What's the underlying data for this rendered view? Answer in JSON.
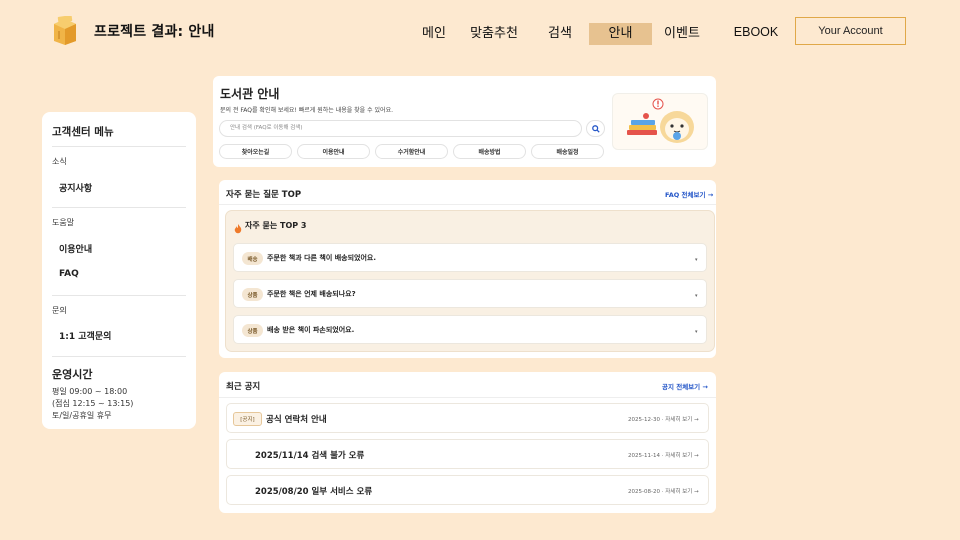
{
  "header": {
    "brand": "프로젝트 결과: 안내",
    "nav": [
      "메인",
      "맞춤추천",
      "검색",
      "안내",
      "이벤트",
      "EBOOK"
    ],
    "active_nav": "안내",
    "account_label": "Your Account"
  },
  "sidebar": {
    "title": "고객센터 메뉴",
    "sections": [
      {
        "heading": "소식",
        "items": [
          "공지사항"
        ]
      },
      {
        "heading": "도움말",
        "items": [
          "이용안내",
          "FAQ"
        ]
      },
      {
        "heading": "문의",
        "items": [
          "1:1 고객문의"
        ]
      }
    ],
    "hours": {
      "title": "운영시간",
      "lines": [
        "평일 09:00 ~ 18:00",
        "(점심 12:15 ~ 13:15)",
        "토/일/공휴일 휴무"
      ]
    }
  },
  "info": {
    "title": "도서관 안내",
    "subtitle": "문의 전 FAQ를 확인해 보세요! 빠르게 원하는 내용을 찾을 수 있어요.",
    "search_placeholder": "안내 검색 (FAQ로 이동해 검색)",
    "quick_links": [
      "찾아오는길",
      "이용안내",
      "수거함안내",
      "배송방법",
      "배송일정"
    ]
  },
  "faq": {
    "title": "자주 묻는 질문 TOP",
    "link": "FAQ 전체보기 →",
    "top_title": "자주 묻는 TOP 3",
    "items": [
      {
        "tag": "배송",
        "question": "주문한 책과 다른 책이 배송되었어요."
      },
      {
        "tag": "상품",
        "question": "주문한 책은 언제 배송되나요?"
      },
      {
        "tag": "상품",
        "question": "배송 받은 책이 파손되었어요."
      }
    ]
  },
  "notices": {
    "title": "최근 공지",
    "link": "공지 전체보기 →",
    "items": [
      {
        "tag": "[공지]",
        "title": "공식 연락처 안내",
        "meta": "2025-12-30 · 자세히 보기 →"
      },
      {
        "tag": "",
        "title": "2025/11/14 검색 불가 오류",
        "meta": "2025-11-14 · 자세히 보기 →"
      },
      {
        "tag": "",
        "title": "2025/08/20 일부 서비스 오류",
        "meta": "2025-08-20 · 자세히 보기 →"
      }
    ]
  },
  "icons": {
    "logo": "book-box-icon",
    "search": "magnifier-icon",
    "faq_fire": "fire-icon",
    "chevron": "chevron-down-icon"
  },
  "colors": {
    "background": "#fde9d0",
    "nav_active": "#e7c290",
    "account_border": "#e0a848",
    "link": "#2456c8"
  }
}
